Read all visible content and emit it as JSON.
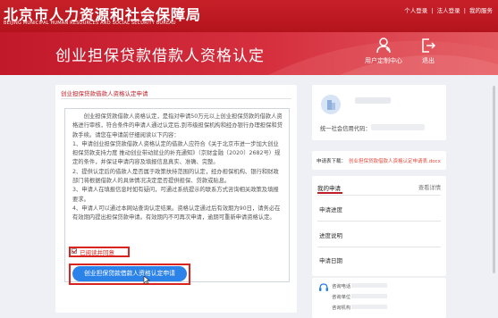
{
  "header": {
    "brand_cn": "北京市人力资源和社会保障局",
    "brand_en": "BEIJING MUNICIPAL HUMAN RESOURCES AND SOCIAL SECURITY BUREAU",
    "links": [
      "个人登录",
      "法人登录",
      "我的服务"
    ],
    "separator": "|"
  },
  "banner": {
    "title": "创业担保贷款借款人资格认定",
    "user_center": "用户定制中心",
    "logout": "退出"
  },
  "main": {
    "section_title": "创业担保贷款借款人资格认定申请",
    "paragraphs": [
      "创业担保贷款借款人资格认定，是指对申请50万元以上创业担保贷款的借款人资格进行审核，符合条件的申请人通过认定后,到市级担保机构和经办银行办理担保和贷款手续。请您在申请前仔细阅读以下内容：",
      "1、申请创业担保贷款借款人资格认定的借款人应符合《关于北京市进一步加大创业担保贷款支持力度 推动创业带动就业的补充通知》（京财金融〔2020〕2682号）规定的条件，并保证申请内容及填报信息真实、准确、完整。",
      "2、提供认定后的借款人是否属于政策扶持范围的认定，经办担保机构、银行和财政部门将根据借款人的具体情况决定是否提供担保、贷款或贴息。",
      "3、申请人在填报信息时如有疑问，可通过系统提示的联系方式咨询相关政策及填报要求。",
      "4、申请人可以通过本网站查询认定结果。资格认定通过后有效期为90日，请务必在有效期内提出担保贷款申请。有效期内不可再次申请，逾期可重新申请资格认定。"
    ],
    "agree_label": "已阅读并同意",
    "apply_button": "创业担保贷款借款人资格认定申请"
  },
  "sidebar": {
    "credit_code_label": "统一社会信用代码：",
    "download_label": "申请表下载：",
    "download_link": "创业担保贷款借款人资格认定申请表.docx",
    "my_application": "我的申请",
    "view_details": "查看详情",
    "rows": [
      "申请进度",
      "进度说明",
      "申请日期"
    ],
    "consult_labels": [
      "咨询电话：",
      "咨询单位：",
      "咨询机构："
    ]
  },
  "colors": {
    "header_red": "#b3141c",
    "accent_red": "#c01e28",
    "highlight_red": "#d9231e",
    "button_blue": "#2b82e8"
  }
}
